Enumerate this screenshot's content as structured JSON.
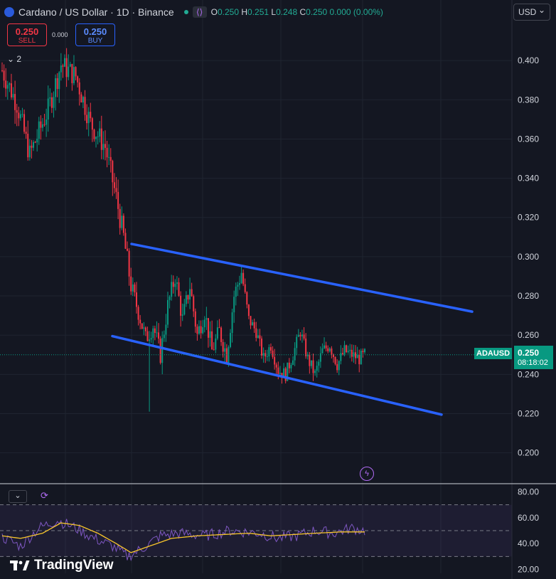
{
  "header": {
    "title": "Cardano / US Dollar · 1D · Binance",
    "ohlc": [
      {
        "k": "O",
        "v": "0.250"
      },
      {
        "k": "H",
        "v": "0.251"
      },
      {
        "k": "L",
        "v": "0.248"
      },
      {
        "k": "C",
        "v": "0.250"
      },
      {
        "k": "",
        "v": "0.000 (0.00%)"
      }
    ]
  },
  "trade": {
    "sell_price": "0.250",
    "sell_label": "SELL",
    "buy_price": "0.250",
    "buy_label": "BUY",
    "spread": "0.000"
  },
  "indicators_count": "2",
  "currency": "USD",
  "last_price": {
    "symbol": "ADAUSD",
    "price": "0.250",
    "countdown": "08:18:02"
  },
  "brand": "TradingView",
  "colors": {
    "background": "#141722",
    "up": "#089981",
    "down": "#f23645",
    "trendline": "#2962ff",
    "rsi": "#7e57c2",
    "rsi_ma": "#f7c52b",
    "grid": "#1f2430"
  },
  "chart_data": [
    {
      "type": "candlestick",
      "title": "Cardano / US Dollar · 1D · Binance",
      "ylim": [
        0.185,
        0.42
      ],
      "yticks": [
        0.2,
        0.22,
        0.24,
        0.26,
        0.28,
        0.3,
        0.32,
        0.34,
        0.36,
        0.38,
        0.4
      ],
      "ytick_labels": [
        "0.200",
        "0.220",
        "0.240",
        "0.260",
        "0.280",
        "0.300",
        "0.320",
        "0.340",
        "0.360",
        "0.380",
        "0.400"
      ],
      "grid": true,
      "anchor_closes": [
        [
          0,
          0.395
        ],
        [
          8,
          0.378
        ],
        [
          15,
          0.352
        ],
        [
          25,
          0.375
        ],
        [
          32,
          0.398
        ],
        [
          40,
          0.392
        ],
        [
          48,
          0.368
        ],
        [
          56,
          0.356
        ],
        [
          62,
          0.33
        ],
        [
          66,
          0.31
        ],
        [
          70,
          0.285
        ],
        [
          74,
          0.272
        ],
        [
          78,
          0.258
        ],
        [
          82,
          0.265
        ],
        [
          86,
          0.25
        ],
        [
          90,
          0.275
        ],
        [
          94,
          0.29
        ],
        [
          98,
          0.268
        ],
        [
          102,
          0.285
        ],
        [
          106,
          0.26
        ],
        [
          110,
          0.272
        ],
        [
          114,
          0.252
        ],
        [
          118,
          0.262
        ],
        [
          122,
          0.25
        ],
        [
          126,
          0.28
        ],
        [
          130,
          0.292
        ],
        [
          134,
          0.268
        ],
        [
          138,
          0.262
        ],
        [
          142,
          0.248
        ],
        [
          146,
          0.255
        ],
        [
          150,
          0.242
        ],
        [
          154,
          0.24
        ],
        [
          158,
          0.25
        ],
        [
          162,
          0.262
        ],
        [
          166,
          0.248
        ],
        [
          170,
          0.24
        ],
        [
          174,
          0.252
        ],
        [
          178,
          0.255
        ],
        [
          182,
          0.245
        ],
        [
          186,
          0.252
        ],
        [
          190,
          0.25
        ],
        [
          194,
          0.248
        ],
        [
          197,
          0.25
        ]
      ],
      "trendlines": [
        {
          "name": "upper-channel",
          "points": [
            [
              0.3065,
              0
            ],
            [
              0.272,
              1
            ]
          ]
        },
        {
          "name": "lower-channel",
          "points": [
            [
              0.2595,
              0
            ],
            [
              0.2195,
              1
            ]
          ]
        }
      ],
      "last_price": 0.25
    },
    {
      "type": "line",
      "panel": "RSI",
      "ylim": [
        17,
        83
      ],
      "yticks": [
        20,
        40,
        60,
        80
      ],
      "ytick_labels": [
        "20.00",
        "40.00",
        "60.00",
        "80.00"
      ],
      "bands": [
        30,
        50,
        70
      ],
      "series": [
        {
          "values_anchor": [
            [
              0,
              45
            ],
            [
              10,
              38
            ],
            [
              20,
              52
            ],
            [
              30,
              58
            ],
            [
              40,
              52
            ],
            [
              50,
              44
            ],
            [
              60,
              38
            ],
            [
              68,
              30
            ],
            [
              76,
              36
            ],
            [
              86,
              46
            ],
            [
              96,
              48
            ],
            [
              110,
              46
            ],
            [
              124,
              50
            ],
            [
              140,
              48
            ],
            [
              150,
              44
            ],
            [
              160,
              46
            ],
            [
              170,
              50
            ],
            [
              180,
              48
            ],
            [
              190,
              52
            ],
            [
              197,
              50
            ]
          ]
        },
        {
          "values_anchor": [
            [
              0,
              46
            ],
            [
              10,
              44
            ],
            [
              22,
              48
            ],
            [
              32,
              56
            ],
            [
              42,
              54
            ],
            [
              52,
              48
            ],
            [
              62,
              40
            ],
            [
              70,
              33
            ],
            [
              80,
              38
            ],
            [
              92,
              44
            ],
            [
              106,
              46
            ],
            [
              120,
              47
            ],
            [
              134,
              48
            ],
            [
              146,
              46
            ],
            [
              158,
              47
            ],
            [
              170,
              48
            ],
            [
              184,
              49
            ],
            [
              197,
              49
            ]
          ]
        }
      ]
    }
  ]
}
